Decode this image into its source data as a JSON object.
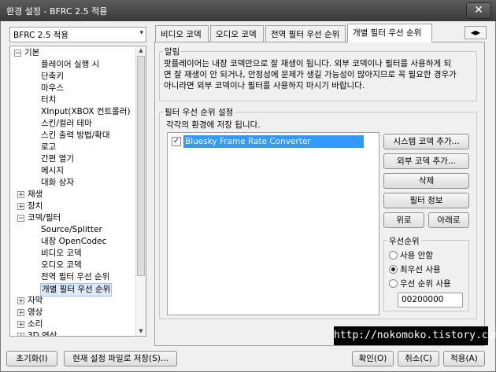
{
  "window": {
    "title": "환경 설정 - BFRC 2.5 적용",
    "close_glyph": "✕"
  },
  "preset": {
    "value": "BFRC 2.5 적용",
    "arrow": "▾"
  },
  "tree": {
    "items": [
      {
        "label": "기본",
        "expander": "−"
      },
      {
        "label": "플레이어 실행 시"
      },
      {
        "label": "단축키"
      },
      {
        "label": "마우스"
      },
      {
        "label": "터치"
      },
      {
        "label": "XInput(XBOX 컨트롤러)"
      },
      {
        "label": "스킨/컬러 테마"
      },
      {
        "label": "스킨 출력 방법/확대"
      },
      {
        "label": "로고"
      },
      {
        "label": "간편 열기"
      },
      {
        "label": "메시지"
      },
      {
        "label": "대화 상자"
      },
      {
        "label": "재생",
        "expander": "+"
      },
      {
        "label": "장치",
        "expander": "+"
      },
      {
        "label": "코덱/필터",
        "expander": "−"
      },
      {
        "label": "Source/Splitter"
      },
      {
        "label": "내장 OpenCodec"
      },
      {
        "label": "비디오 코덱"
      },
      {
        "label": "오디오 코덱"
      },
      {
        "label": "전역 필터 우선 순위"
      },
      {
        "label": "개별 필터 우선 순위"
      },
      {
        "label": "자막",
        "expander": "+"
      },
      {
        "label": "영상",
        "expander": "+"
      },
      {
        "label": "소리",
        "expander": "+"
      },
      {
        "label": "3D 영상",
        "expander": "+"
      }
    ]
  },
  "tabs": [
    {
      "label": "비디오 코덱"
    },
    {
      "label": "오디오 코덱"
    },
    {
      "label": "전역 필터 우선 순위"
    },
    {
      "label": "개별 필터 우선 순위"
    }
  ],
  "tab_scroll": {
    "prev": "◀",
    "next": "▶"
  },
  "notice": {
    "title": "알림",
    "lines": [
      "팟플레이어는 내장 코덱만으로 잘 재생이 됩니다. 외부 코덱이나 필터를 사용하게 되",
      "면 잘 재생이 안 되거나, 안정성에 문제가 생길 가능성이 많아지므로 꼭 필요한 경우가",
      "아니라면 외부 코덱이나 필터를 사용하지 마시기 바랍니다."
    ]
  },
  "filter_priority": {
    "title": "필터 우선 순위 설정",
    "description": "각각의 환경에 저장 됩니다.",
    "items": [
      {
        "label": "Bluesky Frame Rate Converter",
        "checked": true,
        "check_glyph": "✓"
      }
    ],
    "buttons": {
      "add_system": "시스템 코덱 추가...",
      "add_external": "외부 코덱 추가...",
      "delete": "삭제",
      "filter_info": "필터 정보",
      "up": "위로",
      "down": "아래로"
    },
    "priority": {
      "title": "우선순위",
      "options": [
        {
          "label": "사용 안함",
          "selected": false
        },
        {
          "label": "최우선 사용",
          "selected": true
        },
        {
          "label": "우선 순위 사용",
          "selected": false
        }
      ],
      "value": "00200000"
    }
  },
  "footer": {
    "reset": "초기화(I)",
    "save_current": "현재 설정 파일로 저장(S)...",
    "ok": "확인(O)",
    "cancel": "취소(C)",
    "apply": "적용(A)"
  },
  "watermark": "http://nokomoko.tistory.com"
}
